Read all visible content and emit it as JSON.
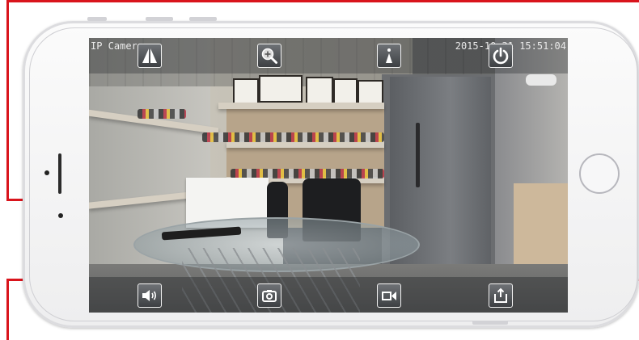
{
  "camera_feed": {
    "osd_label": "IP Camera",
    "timestamp": "2015-10-31 15:51:04"
  },
  "controls": {
    "top": [
      {
        "id": "flip",
        "icon": "flip-icon"
      },
      {
        "id": "zoom",
        "icon": "zoom-in-icon"
      },
      {
        "id": "info",
        "icon": "info-icon"
      },
      {
        "id": "power",
        "icon": "power-icon"
      }
    ],
    "bottom": [
      {
        "id": "audio",
        "icon": "speaker-icon"
      },
      {
        "id": "snapshot",
        "icon": "camera-icon"
      },
      {
        "id": "record",
        "icon": "video-record-icon"
      },
      {
        "id": "share",
        "icon": "share-icon"
      }
    ]
  },
  "colors": {
    "highlight_border": "#d9141c",
    "control_border": "#f3f3f3",
    "overlay_bar": "#28292d"
  }
}
